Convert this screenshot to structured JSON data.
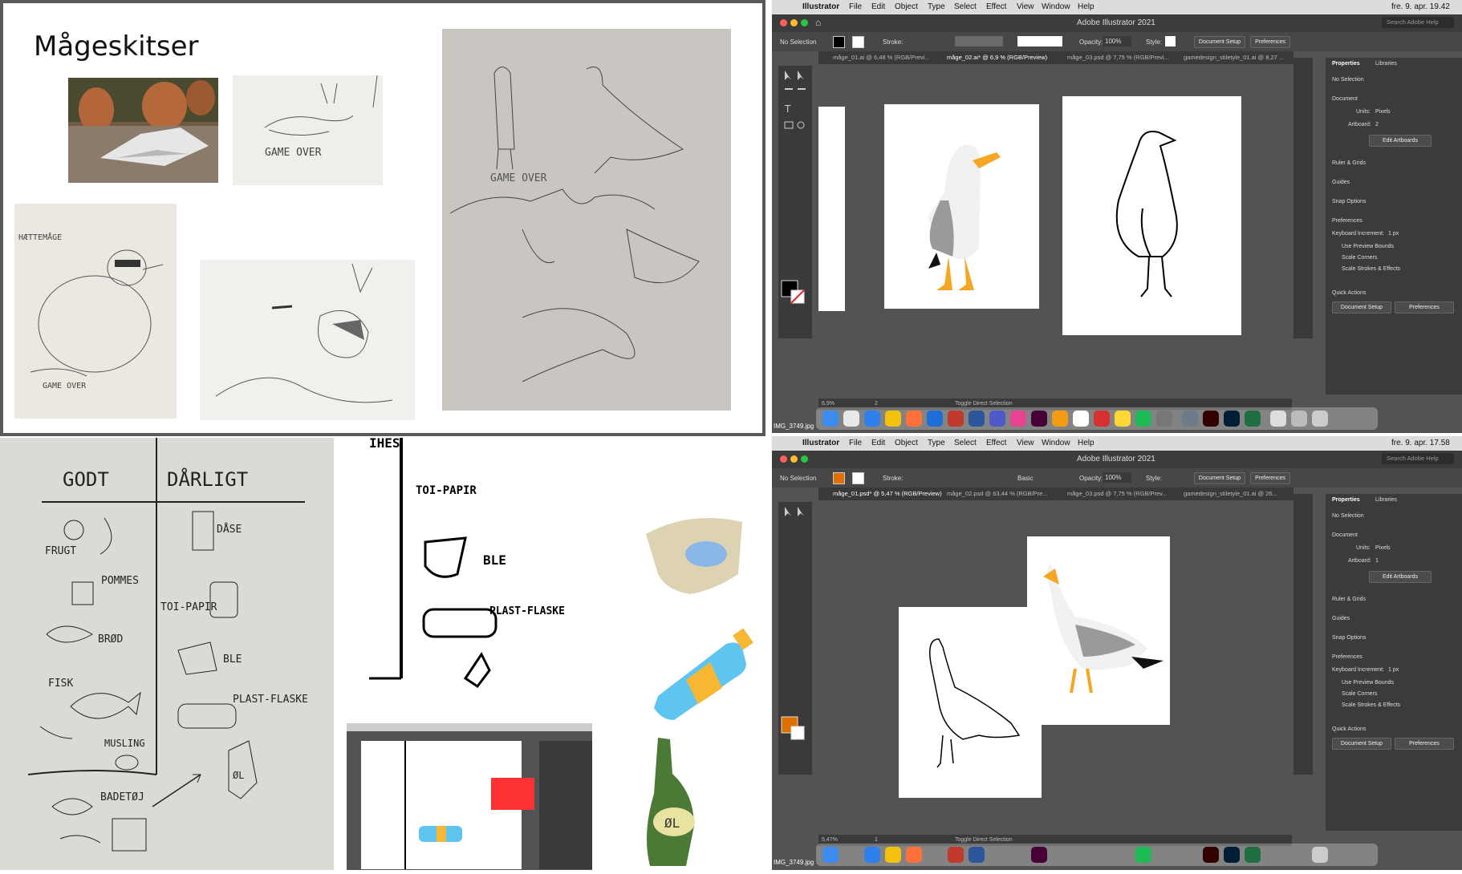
{
  "slide": {
    "title": "Mågeskitser",
    "sketch_texts": [
      "GAME OVER",
      "GAME OVER",
      "GAME OVER",
      "HÆTTEMÅGE"
    ]
  },
  "sketch_lower": {
    "good_header": "GODT",
    "bad_header": "DÅRLIGT",
    "good_items": [
      "FRUGT",
      "POMMES",
      "BRØD",
      "FISK",
      "MUSLING"
    ],
    "bad_items": [
      "DÅSE",
      "TOI-PAPIR",
      "BLE",
      "PLAST-FLASKE"
    ],
    "badetoj": "BADETØJ",
    "beer_label": "ØL"
  },
  "ink_panel": {
    "top": "IHES",
    "toi": "TOI-PAPIR",
    "ble": "BLE",
    "plast": "PLAST-FLASKE"
  },
  "colors": {
    "gull_beak": "#f5a623",
    "gull_grey": "#9a9a9a",
    "bottle_blue": "#5ec4f0",
    "bottle_yellow": "#f7b733",
    "beer_green": "#4a7a35",
    "beer_label": "#e8e3a0",
    "diaper": "#ddd3b2",
    "ai_brand": "#ff7c00"
  },
  "mac_top": {
    "menu": [
      "Illustrator",
      "File",
      "Edit",
      "Object",
      "Type",
      "Select",
      "Effect",
      "View",
      "Window",
      "Help"
    ],
    "clock": "fre. 9. apr. 19.42",
    "app_title": "Adobe Illustrator 2021",
    "search": "Search Adobe Help",
    "selection": "No Selection",
    "stroke_label": "Stroke:",
    "opacity_label": "Opacity:",
    "opacity_value": "100%",
    "style_label": "Style:",
    "doc_setup": "Document Setup",
    "preferences": "Preferences",
    "tabs": [
      "måge_01.ai @ 6,48 % (RGB/Previ...",
      "måge_02.ai* @ 6,9 % (RGB/Preview)",
      "måge_03.psd @ 7,75 % (RGB/Previ...",
      "gamedesign_stiletyle_01.ai @ 8,27 ..."
    ],
    "panel_tabs": [
      "Properties",
      "Libraries"
    ],
    "panel": {
      "no_selection": "No Selection",
      "document": "Document",
      "units_label": "Units:",
      "units_value": "Pixels",
      "artboard_label": "Artboard:",
      "artboard_value": "2",
      "edit_artboards": "Edit Artboards",
      "ruler": "Ruler & Grids",
      "guides": "Guides",
      "snap": "Snap Options",
      "preferences": "Preferences",
      "key_inc_label": "Keyboard Increment:",
      "key_inc_value": "1 px",
      "use_preview": "Use Preview Bounds",
      "scale_corners": "Scale Corners",
      "scale_strokes": "Scale Strokes & Effects",
      "quick_actions": "Quick Actions",
      "doc_setup": "Document Setup",
      "prefs_btn": "Preferences"
    },
    "zoom": "6,9%",
    "page": "2",
    "toggle": "Toggle Direct Selection",
    "desktop_label": "IMG_3749.jpg"
  },
  "mac_bottom": {
    "clock": "fre. 9. apr. 17.58",
    "app_title": "Adobe Illustrator 2021",
    "search": "Search Adobe Help",
    "selection": "No Selection",
    "stroke_label": "Stroke:",
    "basic": "Basic",
    "opacity_label": "Opacity:",
    "opacity_value": "100%",
    "style_label": "Style:",
    "doc_setup": "Document Setup",
    "preferences": "Preferences",
    "tabs": [
      "måge_01.psd* @ 5,47 % (RGB/Preview)",
      "måge_02.psd @ 63,44 % (RGB/Pre...",
      "måge_03.psd @ 7,75 % (RGB/Prev...",
      "gamedesign_stiletyle_01.ai @ 26..."
    ],
    "panel": {
      "artboard_value": "1"
    },
    "zoom": "5,47%",
    "page": "1",
    "toggle": "Toggle Direct Selection",
    "desktop_label": "IMG_3749.jpg"
  }
}
